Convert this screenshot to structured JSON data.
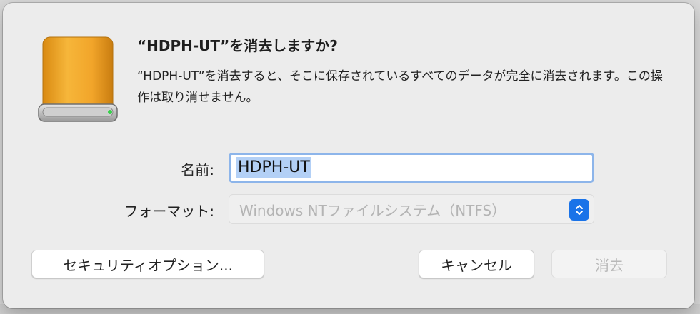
{
  "dialog": {
    "title": "“HDPH-UT”を消去しますか?",
    "message": "“HDPH-UT”を消去すると、そこに保存されているすべてのデータが完全に消去されます。この操作は取り消せません。",
    "icon": "external-drive-icon"
  },
  "form": {
    "name_label": "名前:",
    "name_value": "HDPH-UT",
    "format_label": "フォーマット:",
    "format_value": "Windows NTファイルシステム（NTFS）",
    "stepper_icon": "chevron-updown-icon"
  },
  "buttons": {
    "security_options": "セキュリティオプション...",
    "cancel": "キャンセル",
    "erase": "消去"
  },
  "colors": {
    "accent": "#1a73e8",
    "focus_ring": "#8db5ea",
    "selection": "#b3d0f6",
    "drive_gold": "#f2a52a"
  }
}
